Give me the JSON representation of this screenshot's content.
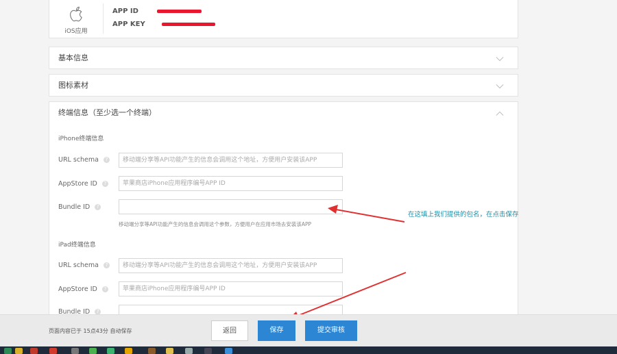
{
  "app_card": {
    "platform_label": "iOS应用",
    "app_id_label": "APP ID",
    "app_key_label": "APP KEY",
    "redaction_color": "#e8172f"
  },
  "sections": {
    "basic_info": "基本信息",
    "icon_assets": "图标素材",
    "terminal_info": "终端信息（至少选一个终端）"
  },
  "iphone": {
    "title": "iPhone终端信息",
    "url_scheme_label": "URL schema",
    "url_scheme_placeholder": "移动端分享等API功能产生的信息会调用这个地址，方便用户安装该APP",
    "appstore_label": "AppStore ID",
    "appstore_placeholder": "苹果商店iPhone应用程序编号APP ID",
    "bundle_label": "Bundle ID",
    "bundle_value": "",
    "bundle_hint": "移动端分享等API功能产生的信息会调用这个参数，方便用户在应用市场去安装该APP"
  },
  "ipad": {
    "title": "iPad终端信息",
    "url_scheme_label": "URL schema",
    "url_scheme_placeholder": "移动端分享等API功能产生的信息会调用这个地址，方便用户安装该APP",
    "appstore_label": "AppStore ID",
    "appstore_placeholder": "苹果商店iPhone应用程序编号APP ID",
    "bundle_label": "Bundle ID"
  },
  "annotation": {
    "text": "在这填上我们提供的包名，在点击保存",
    "arrow_color": "#e03030"
  },
  "bottom_bar": {
    "status": "页面内容已于 15点43分 自动保存",
    "back_label": "返回",
    "save_label": "保存",
    "submit_label": "提交审核"
  },
  "colors": {
    "primary_button": "#2c86d4",
    "annotation_text": "#1a8fa8"
  }
}
